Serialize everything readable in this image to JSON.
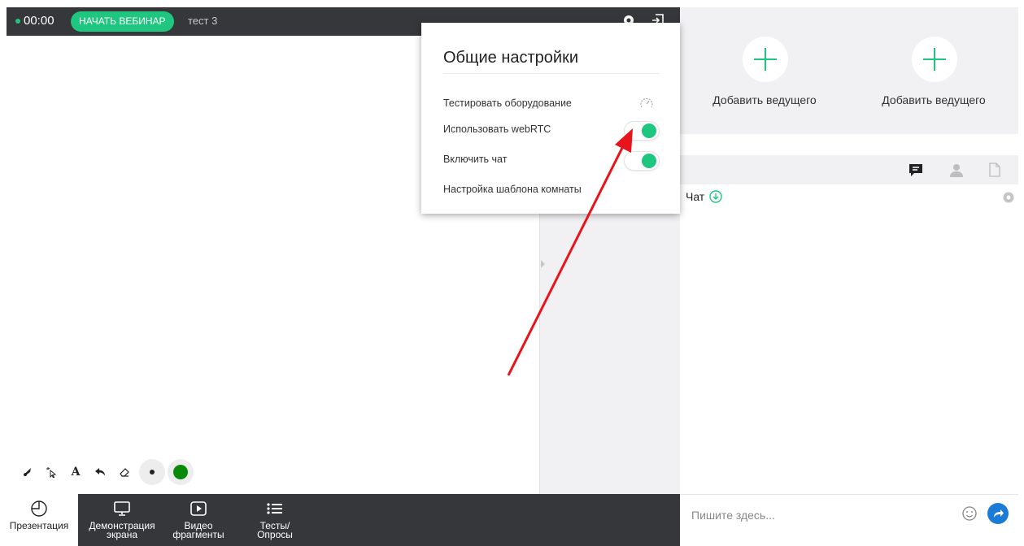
{
  "topbar": {
    "timer": "00:00",
    "start_button": "НАЧАТЬ ВЕБИНАР",
    "room_name": "тест 3",
    "icons": [
      "gear-icon",
      "exit-icon"
    ]
  },
  "settings_popup": {
    "title": "Общие настройки",
    "rows": [
      {
        "label": "Тестировать оборудование",
        "control": "gauge-icon"
      },
      {
        "label": "Использовать webRTC",
        "control": "toggle",
        "on": true
      },
      {
        "label": "Включить чат",
        "control": "toggle",
        "on": true
      },
      {
        "label": "Настройка шаблона комнаты"
      }
    ]
  },
  "hosts": [
    {
      "label": "Добавить ведущего",
      "icon": "plus-icon"
    },
    {
      "label": "Добавить ведущего",
      "icon": "plus-icon"
    }
  ],
  "chat": {
    "tabs": [
      "chat-icon",
      "user-icon",
      "file-icon"
    ],
    "title": "Чат",
    "input_placeholder": "Пишите здесь..."
  },
  "draw_tools": [
    "brush-icon",
    "pointer-icon",
    "text-icon",
    "undo-icon",
    "eraser-icon",
    "dot-size-icon",
    "color-icon"
  ],
  "bottom_tabs": [
    {
      "label_line1": "Презентация",
      "label_line2": "",
      "icon": "pie-chart-icon",
      "active": true
    },
    {
      "label_line1": "Демонстрация",
      "label_line2": "экрана",
      "icon": "monitor-icon",
      "active": false
    },
    {
      "label_line1": "Видео",
      "label_line2": "фрагменты",
      "icon": "play-icon",
      "active": false
    },
    {
      "label_line1": "Тесты/",
      "label_line2": "Опросы",
      "icon": "list-icon",
      "active": false
    }
  ],
  "colors": {
    "accent_green": "#1fc67f",
    "dark_bar": "#35373b",
    "send_blue": "#1d7bd8",
    "annotation_red": "#e8141b",
    "selected_draw_color": "#0a8a0a"
  }
}
